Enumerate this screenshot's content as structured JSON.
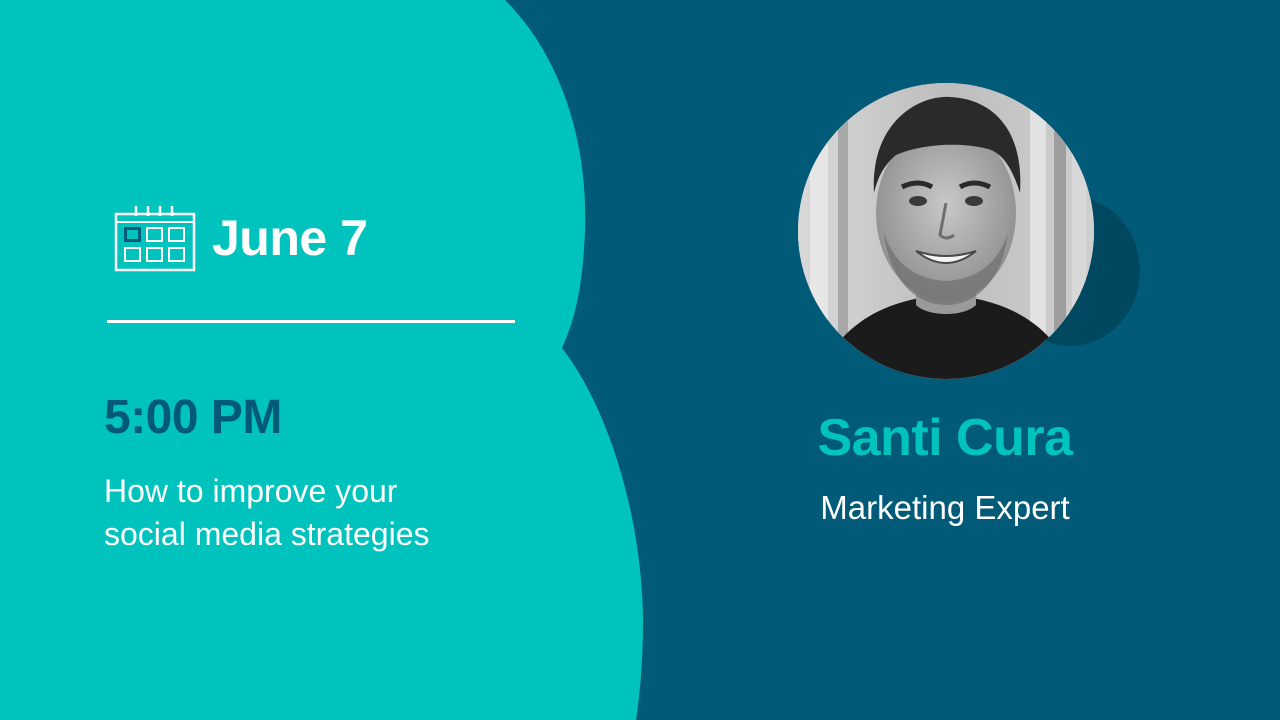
{
  "event": {
    "date": "June 7",
    "time": "5:00 PM",
    "topic_line1": "How to improve your",
    "topic_line2": "social media strategies"
  },
  "speaker": {
    "name": "Santi Cura",
    "role": "Marketing Expert"
  },
  "colors": {
    "teal": "#00c3bd",
    "navy": "#005a78",
    "white": "#ffffff"
  },
  "icons": {
    "calendar": "calendar-icon"
  }
}
